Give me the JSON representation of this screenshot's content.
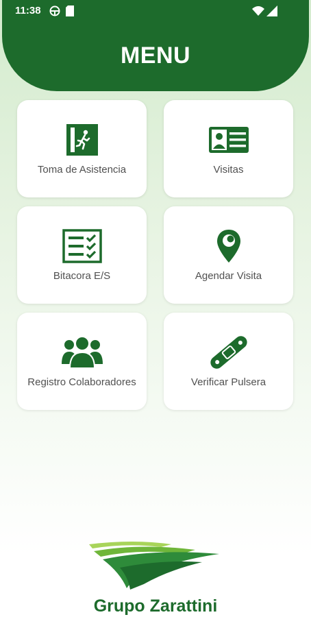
{
  "status_bar": {
    "time": "11:38",
    "left_icons": [
      "sync-icon",
      "sim-card-icon"
    ],
    "right_icons": [
      "wifi-icon",
      "cell-signal-icon"
    ]
  },
  "header": {
    "title": "MENU",
    "color": "#1d6b2c"
  },
  "menu": {
    "items": [
      {
        "label": "Toma de Asistencia",
        "icon": "emergency-exit-icon"
      },
      {
        "label": "Visitas",
        "icon": "id-card-icon"
      },
      {
        "label": "Bitacora E/S",
        "icon": "checklist-icon"
      },
      {
        "label": "Agendar Visita",
        "icon": "map-pin-icon"
      },
      {
        "label": "Registro Colaboradores",
        "icon": "users-group-icon"
      },
      {
        "label": "Verificar Pulsera",
        "icon": "wristband-icon"
      }
    ]
  },
  "footer": {
    "brand": "Grupo Zarattini",
    "logo_icon": "zarattini-logo-icon"
  },
  "colors": {
    "accent": "#1d6b2c",
    "label": "#505050"
  }
}
